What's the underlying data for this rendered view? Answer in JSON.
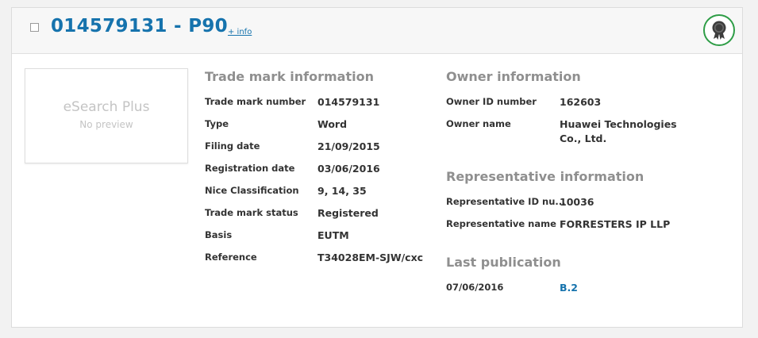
{
  "header": {
    "title": "014579131 - P90",
    "info_link": "+ info",
    "badge_icon": "award-ribbon-icon",
    "badge_color": "#2e9d46"
  },
  "preview": {
    "title": "eSearch Plus",
    "subtitle": "No preview"
  },
  "trade_mark": {
    "heading": "Trade mark information",
    "rows": [
      {
        "label": "Trade mark number",
        "value": "014579131"
      },
      {
        "label": "Type",
        "value": "Word"
      },
      {
        "label": "Filing date",
        "value": "21/09/2015"
      },
      {
        "label": "Registration date",
        "value": "03/06/2016"
      },
      {
        "label": "Nice Classification",
        "value": "9, 14, 35"
      },
      {
        "label": "Trade mark status",
        "value": "Registered"
      },
      {
        "label": "Basis",
        "value": "EUTM"
      },
      {
        "label": "Reference",
        "value": "T34028EM-SJW/cxc"
      }
    ]
  },
  "owner": {
    "heading": "Owner information",
    "rows": [
      {
        "label": "Owner ID number",
        "value": "162603"
      },
      {
        "label": "Owner name",
        "value": "Huawei Technologies Co., Ltd."
      }
    ]
  },
  "representative": {
    "heading": "Representative information",
    "rows": [
      {
        "label": "Representative ID nu...",
        "value": "10036"
      },
      {
        "label": "Representative name",
        "value": "FORRESTERS IP LLP"
      }
    ]
  },
  "publication": {
    "heading": "Last publication",
    "rows": [
      {
        "label": "07/06/2016",
        "value": "B.2"
      }
    ]
  },
  "colors": {
    "link": "#1673ad",
    "heading": "#8f8f8f",
    "text": "#333333"
  }
}
